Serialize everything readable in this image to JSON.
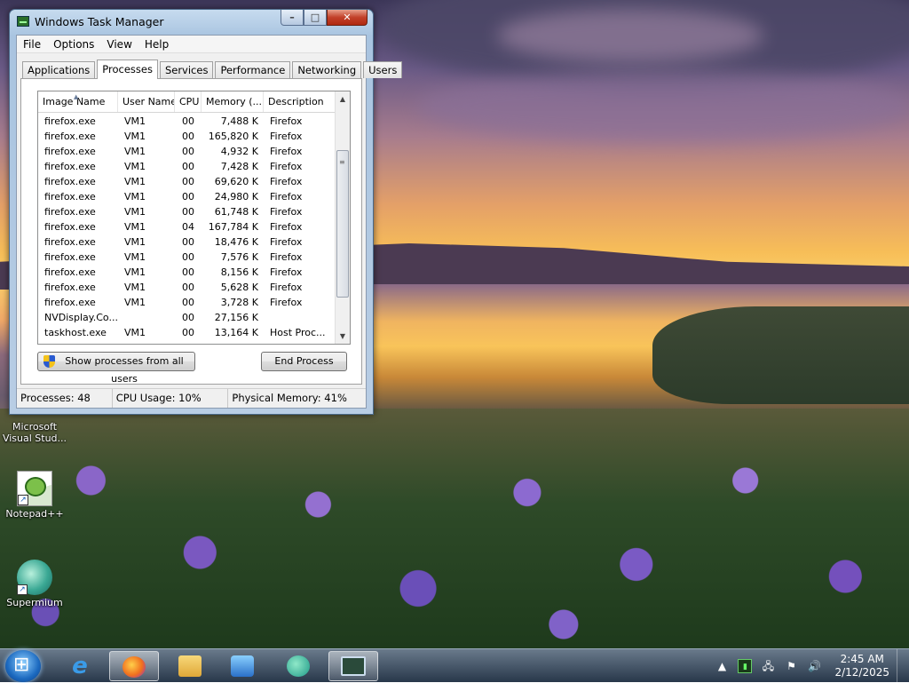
{
  "window": {
    "title": "Windows Task Manager",
    "menu": [
      "File",
      "Options",
      "View",
      "Help"
    ],
    "tabs": [
      "Applications",
      "Processes",
      "Services",
      "Performance",
      "Networking",
      "Users"
    ],
    "active_tab": "Processes"
  },
  "table": {
    "columns": [
      "Image Name",
      "User Name",
      "CPU",
      "Memory (...",
      "Description"
    ],
    "rows": [
      [
        "firefox.exe",
        "VM1",
        "00",
        "7,488 K",
        "Firefox"
      ],
      [
        "firefox.exe",
        "VM1",
        "00",
        "165,820 K",
        "Firefox"
      ],
      [
        "firefox.exe",
        "VM1",
        "00",
        "4,932 K",
        "Firefox"
      ],
      [
        "firefox.exe",
        "VM1",
        "00",
        "7,428 K",
        "Firefox"
      ],
      [
        "firefox.exe",
        "VM1",
        "00",
        "69,620 K",
        "Firefox"
      ],
      [
        "firefox.exe",
        "VM1",
        "00",
        "24,980 K",
        "Firefox"
      ],
      [
        "firefox.exe",
        "VM1",
        "00",
        "61,748 K",
        "Firefox"
      ],
      [
        "firefox.exe",
        "VM1",
        "04",
        "167,784 K",
        "Firefox"
      ],
      [
        "firefox.exe",
        "VM1",
        "00",
        "18,476 K",
        "Firefox"
      ],
      [
        "firefox.exe",
        "VM1",
        "00",
        "7,576 K",
        "Firefox"
      ],
      [
        "firefox.exe",
        "VM1",
        "00",
        "8,156 K",
        "Firefox"
      ],
      [
        "firefox.exe",
        "VM1",
        "00",
        "5,628 K",
        "Firefox"
      ],
      [
        "firefox.exe",
        "VM1",
        "00",
        "3,728 K",
        "Firefox"
      ],
      [
        "NVDisplay.Co...",
        "",
        "00",
        "27,156 K",
        ""
      ],
      [
        "taskhost.exe",
        "VM1",
        "00",
        "13,164 K",
        "Host Proc..."
      ]
    ]
  },
  "buttons": {
    "show_all": "Show processes from all users",
    "end_process": "End Process"
  },
  "status": {
    "processes": "Processes: 48",
    "cpu": "CPU Usage: 10%",
    "memory": "Physical Memory: 41%"
  },
  "desktop_icons": [
    {
      "label": "Microsoft Visual Stud...",
      "icon": "visual-studio-icon"
    },
    {
      "label": "Notepad++",
      "icon": "notepad-plus-plus-icon"
    },
    {
      "label": "Supermium",
      "icon": "supermium-icon"
    }
  ],
  "taskbar": {
    "apps": [
      "internet-explorer",
      "firefox",
      "file-explorer",
      "media-player",
      "supermium",
      "task-manager"
    ],
    "time": "2:45 AM",
    "date": "2/12/2025"
  }
}
